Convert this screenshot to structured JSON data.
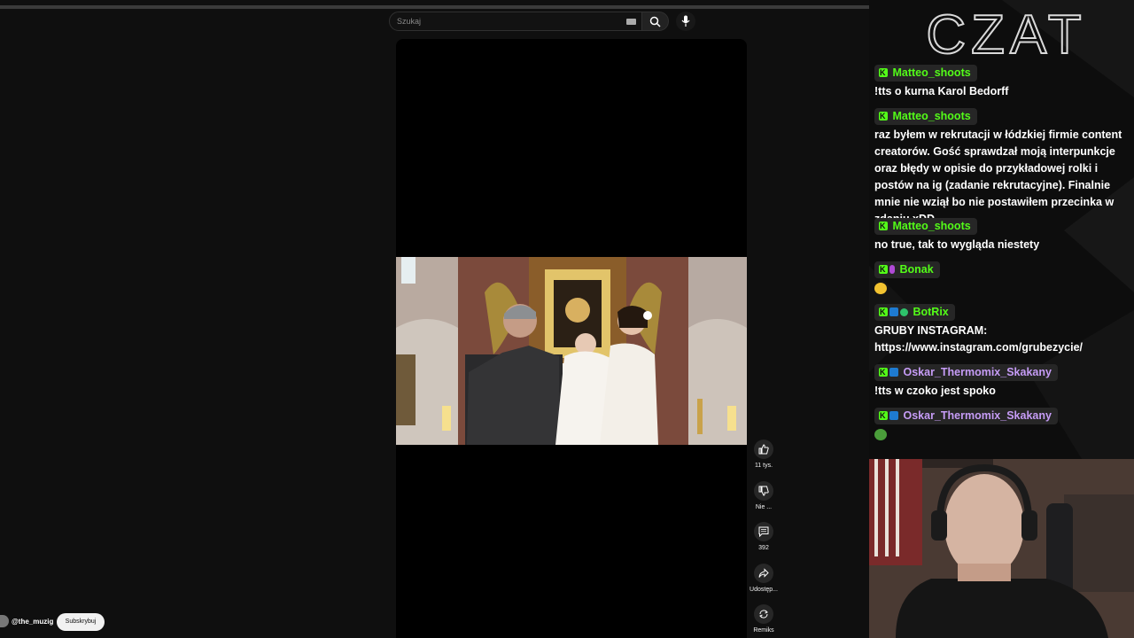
{
  "search": {
    "placeholder": "Szukaj"
  },
  "short": {
    "actions": {
      "like_count": "11 tys.",
      "dislike_label": "Nie ...",
      "comments_count": "392",
      "share_label": "Udostęp...",
      "remix_label": "Remiks"
    },
    "channel": {
      "handle": "@the_muzig",
      "subscribe_label": "Subskrybuj"
    }
  },
  "chat": {
    "title": "CZAT",
    "messages": [
      {
        "user": "Matteo_shoots",
        "color": "#53fc18",
        "text": "!tts o kurna Karol Bedorff"
      },
      {
        "user": "Matteo_shoots",
        "color": "#53fc18",
        "text": "raz byłem w rekrutacji w łódzkiej firmie content creatorów. Gość sprawdzał moją interpunkcje oraz błędy w opisie do przykładowej rolki i postów na ig (zadanie rekrutacyjne). Finalnie mnie nie wziął bo nie postawiłem przecinka w zdaniu xDD"
      },
      {
        "user": "Matteo_shoots",
        "color": "#53fc18",
        "text": "no true, tak to wygląda niestety"
      },
      {
        "user": "Bonak",
        "color": "#53fc18",
        "text": ""
      },
      {
        "user": "BotRix",
        "color": "#53fc18",
        "text": "GRUBY INSTAGRAM: https://www.instagram.com/grubezycie/"
      },
      {
        "user": "Oskar_Thermomix_Skakany",
        "color": "#c69cf6",
        "text": "!tts w czoko jest spoko"
      },
      {
        "user": "Oskar_Thermomix_Skakany",
        "color": "#c69cf6",
        "text": ""
      }
    ]
  }
}
